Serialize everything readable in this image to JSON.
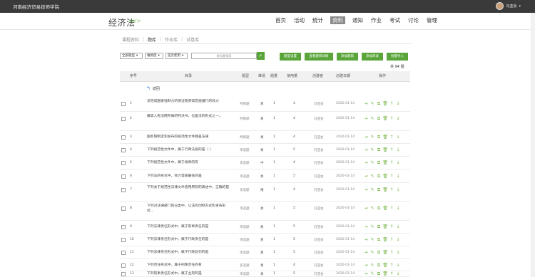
{
  "topbar": {
    "school": "河南经济贸易技师学院",
    "user": "冯亚会"
  },
  "course": {
    "title": "经济法",
    "subtitle": "课程门户"
  },
  "nav": [
    {
      "label": "首页"
    },
    {
      "label": "活动"
    },
    {
      "label": "统计"
    },
    {
      "label": "资料",
      "active": true
    },
    {
      "label": "通知"
    },
    {
      "label": "作业"
    },
    {
      "label": "考试"
    },
    {
      "label": "讨论"
    },
    {
      "label": "管理"
    }
  ],
  "subtabs": [
    {
      "label": "课程资料"
    },
    {
      "label": "题库",
      "active": true
    },
    {
      "label": "作业库"
    },
    {
      "label": "试卷库"
    }
  ],
  "filters": {
    "type": "全部题型",
    "difficulty": "难易度",
    "used": "是否使用",
    "search_placeholder": "按标题搜索"
  },
  "buttons": {
    "settings": "题型设置",
    "view_detail": "查看题目详情",
    "add_question": "添加题目",
    "add_folder": "添加目录",
    "batch_import": "批量导入"
  },
  "count": {
    "prefix": "共",
    "value": "94",
    "suffix": "题"
  },
  "table": {
    "headers": {
      "no": "序号",
      "title": "目录",
      "type": "题型",
      "difficulty": "难易",
      "count": "题量",
      "usage": "使用量",
      "creator": "创建者",
      "date": "创建日期",
      "ops": "操作"
    },
    "return_label": "返回",
    "rows": [
      {
        "no": "1",
        "title": "法完成国家强制力的保证而获得普遍遵行的效力",
        "type": "判断题",
        "difficulty": "易",
        "count": "1",
        "usage": "4",
        "creator": "冯亚会",
        "date": "2020-01-14"
      },
      {
        "no": "2",
        "title": "最高人民法院所做的判决书，也是法的形式之一。",
        "type": "判断题",
        "difficulty": "易",
        "count": "1",
        "usage": "4",
        "creator": "冯亚会",
        "date": "2020-01-14"
      },
      {
        "no": "3",
        "title": "国务院制定和发布的规范性文件都是法律",
        "type": "判断题",
        "difficulty": "易",
        "count": "1",
        "usage": "4",
        "creator": "冯亚会",
        "date": "2020-01-14"
      },
      {
        "no": "4",
        "title": "下列规范性文件中，属于行政法规的是（  ）",
        "type": "单选题",
        "difficulty": "易",
        "count": "1",
        "usage": "5",
        "creator": "冯亚会",
        "date": "2020-01-14"
      },
      {
        "no": "5",
        "title": "下列规范性文件中，属于规章的有",
        "type": "多选题",
        "difficulty": "中",
        "count": "1",
        "usage": "4",
        "creator": "冯亚会",
        "date": "2020-01-14"
      },
      {
        "no": "6",
        "title": "下列法的形式中，效力等级最低的是",
        "type": "单选题",
        "difficulty": "易",
        "count": "1",
        "usage": "5",
        "creator": "冯亚会",
        "date": "2020-01-14"
      },
      {
        "no": "7",
        "title": "下列关于规范性法律文件适用原则的表述中，正确的是",
        "type": "多选题",
        "difficulty": "难",
        "count": "1",
        "usage": "4",
        "creator": "冯亚会",
        "date": "2020-01-14"
      },
      {
        "no": "8",
        "title": "下列对法律部门的分类中，以法的创制方式和发布形式...",
        "type": "单选题",
        "difficulty": "易",
        "count": "1",
        "usage": "5",
        "creator": "冯亚会",
        "date": "2020-01-14"
      },
      {
        "no": "9",
        "title": "下列法律责任形式中，属于刑事责任的是",
        "type": "单选题",
        "difficulty": "易",
        "count": "1",
        "usage": "5",
        "creator": "冯亚会",
        "date": "2020-01-14"
      },
      {
        "no": "10",
        "title": "下列法律责任形式中，属于行政责任的是",
        "type": "单选题",
        "difficulty": "易",
        "count": "1",
        "usage": "5",
        "creator": "冯亚会",
        "date": "2020-01-14"
      },
      {
        "no": "11",
        "title": "下列法律责任形式中，属于行政处罚的是",
        "type": "单选题",
        "difficulty": "易",
        "count": "1",
        "usage": "5",
        "creator": "冯亚会",
        "date": "2020-01-14"
      },
      {
        "no": "12",
        "title": "下列责任形式中，属于刑事责任的有",
        "type": "多选题",
        "difficulty": "易",
        "count": "1",
        "usage": "4",
        "creator": "冯亚会",
        "date": "2020-01-14"
      },
      {
        "no": "13",
        "title": "下列刑事责任形式中，属于主刑的是",
        "type": "单选题",
        "difficulty": "易",
        "count": "1",
        "usage": "5",
        "creator": "冯亚会",
        "date": "2020-01-14"
      }
    ]
  }
}
